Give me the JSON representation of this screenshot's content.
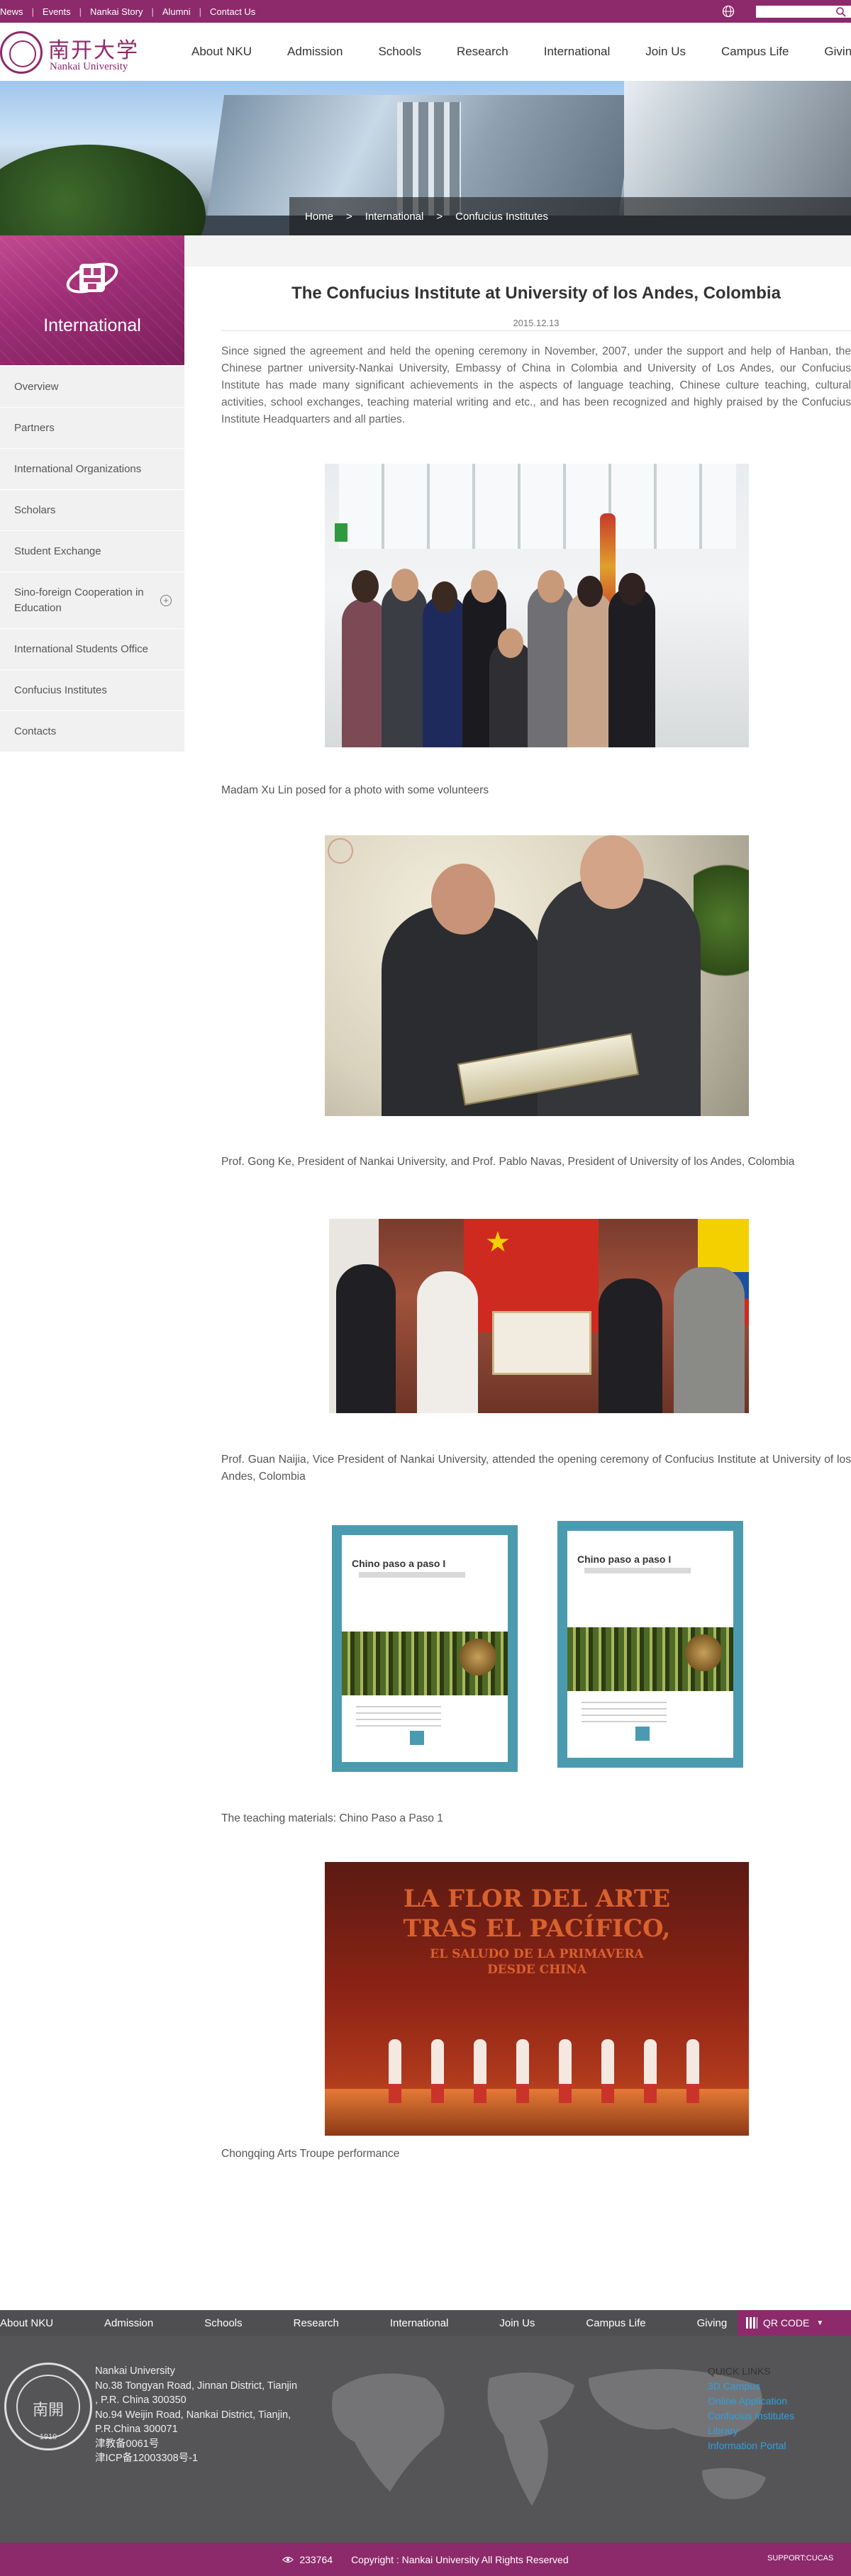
{
  "topbar": {
    "links": [
      "News",
      "Events",
      "Nankai Story",
      "Alumni",
      "Contact Us"
    ],
    "search_placeholder": ""
  },
  "header": {
    "logo_cn": "南开大学",
    "logo_en": "Nankai University",
    "nav": [
      "About NKU",
      "Admission",
      "Schools",
      "Research",
      "International",
      "Join Us",
      "Campus Life",
      "Giving"
    ]
  },
  "breadcrumb": [
    "Home",
    "International",
    "Confucius Institutes"
  ],
  "sidebar": {
    "title": "International",
    "items": [
      {
        "label": "Overview",
        "expandable": false
      },
      {
        "label": "Partners",
        "expandable": false
      },
      {
        "label": "International Organizations",
        "expandable": false
      },
      {
        "label": "Scholars",
        "expandable": false
      },
      {
        "label": "Student Exchange",
        "expandable": false
      },
      {
        "label": "Sino-foreign Cooperation in Education",
        "expandable": true
      },
      {
        "label": "International Students Office",
        "expandable": false
      },
      {
        "label": "Confucius Institutes",
        "expandable": false
      },
      {
        "label": "Contacts",
        "expandable": false
      }
    ]
  },
  "article": {
    "title": "The Confucius Institute at University of los Andes, Colombia",
    "date": "2015.12.13",
    "intro": "Since signed the agreement and held the opening ceremony in November, 2007, under the support and help of Hanban, the Chinese partner university-Nankai University, Embassy of China in Colombia and University of Los Andes, our Confucius Institute has made many significant achievements in the aspects of language teaching, Chinese culture teaching, cultural activities, school exchanges, teaching material writing and etc., and has been recognized and highly praised by the Confucius Institute Headquarters and all parties.",
    "captions": [
      "Madam Xu Lin posed for a photo with some volunteers",
      "Prof. Gong Ke, President of Nankai University, and Prof. Pablo Navas, President of University of los Andes, Colombia",
      "Prof. Guan Naijia, Vice President of Nankai University, attended the opening ceremony of Confucius Institute at University of los Andes, Colombia",
      "The teaching materials: Chino Paso a Paso 1",
      "Chongqing Arts Troupe performance"
    ],
    "book_title": "Chino paso a paso I",
    "poster_lines": [
      "LA FLOR DEL ARTE",
      "TRAS EL PACÍFICO,",
      "EL SALUDO DE LA PRIMAVERA",
      "DESDE CHINA"
    ]
  },
  "footer": {
    "nav": [
      "About NKU",
      "Admission",
      "Schools",
      "Research",
      "International",
      "Join Us",
      "Campus Life",
      "Giving"
    ],
    "qr_label": "QR CODE",
    "seal_name": "南開",
    "seal_year": "1919",
    "address_lines": [
      "Nankai University",
      "No.38 Tongyan Road, Jinnan District, Tianjin",
      ", P.R. China 300350",
      "No.94 Weijin Road,  Nankai District, Tianjin,",
      "P.R.China  300071",
      "津教备0061号",
      "津ICP备12003308号-1"
    ],
    "quick_links_title": "QUICK LINKS",
    "quick_links": [
      "3D Campus",
      "Online Application",
      "Confucius Institutes",
      "Library",
      "Information Portal"
    ],
    "visit_count": "233764",
    "copyright": "Copyright : Nankai University All Rights Reserved",
    "support": "SUPPORT:CUCAS"
  },
  "colors": {
    "brand": "#8c2a6b",
    "footer_gray": "#555558",
    "link_blue": "#2ea0e0"
  }
}
